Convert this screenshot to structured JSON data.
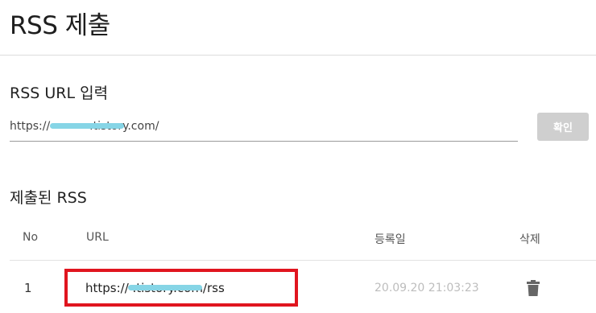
{
  "page": {
    "title": "RSS 제출"
  },
  "input_section": {
    "title": "RSS URL 입력",
    "placeholder": "https://",
    "value": "https://           .tistory.com/",
    "confirm_label": "확인"
  },
  "submitted_section": {
    "title": "제출된 RSS",
    "columns": {
      "no": "No",
      "url": "URL",
      "date": "등록일",
      "delete": "삭제"
    },
    "rows": [
      {
        "no": "1",
        "url": "https://               .tistory.com/rss",
        "date": "20.09.20 21:03:23",
        "delete_icon": "trash-icon"
      }
    ]
  },
  "colors": {
    "highlight": "#e0151f",
    "redaction": "#86d5e6",
    "button_disabled": "#cfcfcf"
  }
}
